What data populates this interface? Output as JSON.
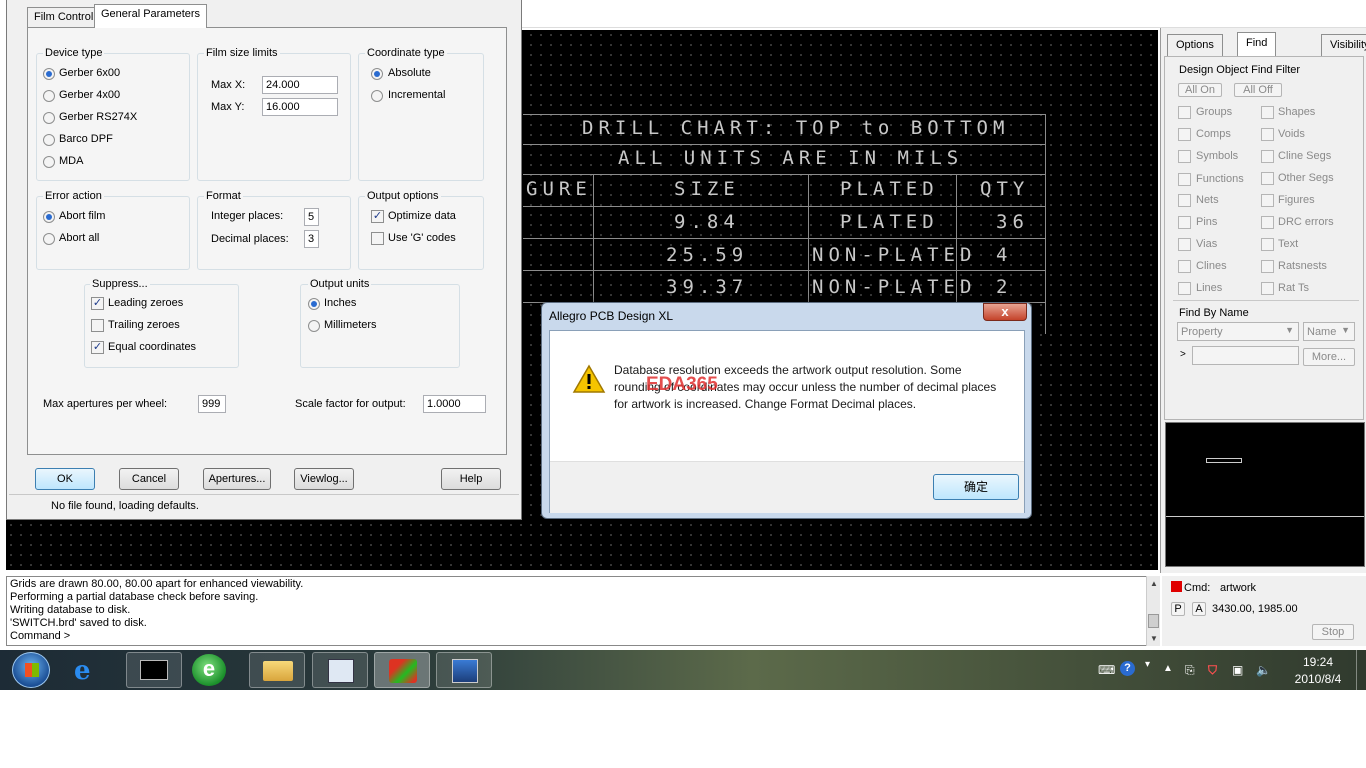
{
  "film_dialog": {
    "tabs": [
      "Film Control",
      "General Parameters"
    ],
    "active_tab": "General Parameters",
    "device_type": {
      "title": "Device type",
      "options": [
        "Gerber 6x00",
        "Gerber 4x00",
        "Gerber RS274X",
        "Barco DPF",
        "MDA"
      ],
      "selected": "Gerber 6x00"
    },
    "film_size": {
      "title": "Film size limits",
      "max_x_label": "Max X:",
      "max_x": "24.000",
      "max_y_label": "Max Y:",
      "max_y": "16.000"
    },
    "coordinate_type": {
      "title": "Coordinate type",
      "options": [
        "Absolute",
        "Incremental"
      ],
      "selected": "Absolute"
    },
    "error_action": {
      "title": "Error action",
      "options": [
        "Abort film",
        "Abort all"
      ],
      "selected": "Abort film"
    },
    "format": {
      "title": "Format",
      "integer_label": "Integer places:",
      "integer_value": "5",
      "decimal_label": "Decimal places:",
      "decimal_value": "3"
    },
    "output_options": {
      "title": "Output options",
      "optimize_label": "Optimize data",
      "optimize_checked": true,
      "gcodes_label": "Use 'G' codes",
      "gcodes_checked": false
    },
    "suppress": {
      "title": "Suppress...",
      "leading_label": "Leading zeroes",
      "leading_checked": true,
      "trailing_label": "Trailing zeroes",
      "trailing_checked": false,
      "equal_label": "Equal coordinates",
      "equal_checked": true
    },
    "output_units": {
      "title": "Output units",
      "options": [
        "Inches",
        "Millimeters"
      ],
      "selected": "Inches"
    },
    "max_apertures_label": "Max apertures per wheel:",
    "max_apertures": "999",
    "scale_label": "Scale factor for output:",
    "scale_value": "1.0000",
    "buttons": {
      "ok": "OK",
      "cancel": "Cancel",
      "apertures": "Apertures...",
      "viewlog": "Viewlog...",
      "help": "Help"
    },
    "status": "No file found, loading defaults."
  },
  "drill_chart": {
    "title_row1": "DRILL CHART: TOP to BOTTOM",
    "title_row2": "ALL UNITS ARE IN MILS",
    "headers": [
      "GURE",
      "SIZE",
      "PLATED",
      "QTY"
    ],
    "rows": [
      [
        "9.84",
        "PLATED",
        "36"
      ],
      [
        "25.59",
        "NON-PLATED",
        "4"
      ],
      [
        "39.37",
        "NON-PLATED",
        "2"
      ]
    ]
  },
  "right_panel": {
    "tabs": [
      "Options",
      "Find",
      "Visibility"
    ],
    "active_tab": "Find",
    "filter_title": "Design Object Find Filter",
    "all_on": "All On",
    "all_off": "All Off",
    "left_items": [
      "Groups",
      "Comps",
      "Symbols",
      "Functions",
      "Nets",
      "Pins",
      "Vias",
      "Clines",
      "Lines"
    ],
    "right_items": [
      "Shapes",
      "Voids",
      "Cline Segs",
      "Other Segs",
      "Figures",
      "DRC errors",
      "Text",
      "Ratsnests",
      "Rat Ts"
    ],
    "find_by_name_title": "Find By Name",
    "property": "Property",
    "name": "Name",
    "more": "More..."
  },
  "alert": {
    "title": "Allegro PCB Design XL",
    "close": "x",
    "message": "Database resolution exceeds the artwork output resolution. Some rounding of coordinates may occur unless the number of decimal places for artwork is increased. Change Format Decimal places.",
    "watermark": "EDA365",
    "ok": "确定"
  },
  "console": {
    "lines": [
      "Grids are drawn 80.00, 80.00 apart for enhanced viewability.",
      "Performing a partial database check before saving.",
      "Writing database to disk.",
      "'SWITCH.brd' saved to disk.",
      "Command >"
    ]
  },
  "cmd_panel": {
    "cmd_label": "Cmd:",
    "cmd_value": "artwork",
    "p": "P",
    "a": "A",
    "coords": "3430.00, 1985.00",
    "stop": "Stop"
  },
  "taskbar": {
    "time": "19:24",
    "date": "2010/8/4"
  },
  "colors": {
    "accent": "#2a6bd0",
    "canvas": "#000000",
    "cmd_indicator": "#e00000"
  }
}
